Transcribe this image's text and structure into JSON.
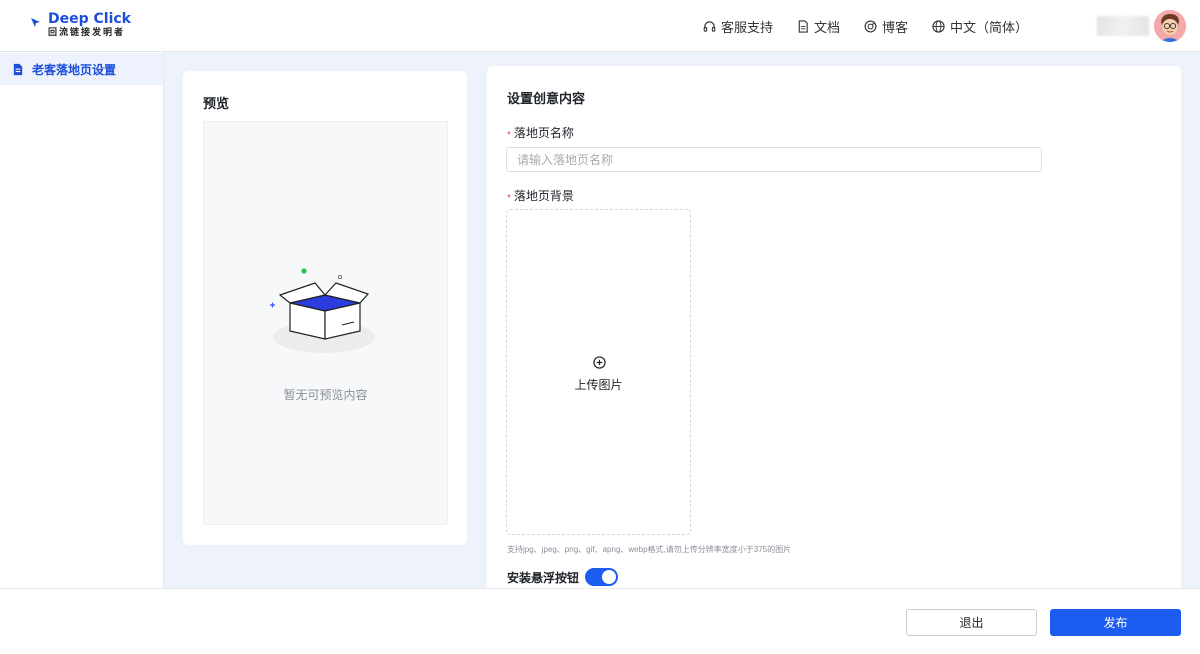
{
  "header": {
    "logo_title": "Deep Click",
    "logo_subtitle": "回流链接发明者",
    "nav": [
      {
        "label": "客服支持",
        "icon": "headset-icon"
      },
      {
        "label": "文档",
        "icon": "document-icon"
      },
      {
        "label": "博客",
        "icon": "blog-icon"
      },
      {
        "label": "中文（简体）",
        "icon": "globe-icon"
      }
    ]
  },
  "sidebar": {
    "items": [
      {
        "label": "老客落地页设置",
        "icon": "page-settings-icon",
        "active": true
      }
    ]
  },
  "preview": {
    "title": "预览",
    "empty_text": "暂无可预览内容"
  },
  "form": {
    "title": "设置创意内容",
    "name_label": "落地页名称",
    "name_placeholder": "请输入落地页名称",
    "name_value": "",
    "required_mark": "*",
    "background_label": "落地页背景",
    "upload_label": "上传图片",
    "upload_hint": "支持jpg、jpeg、png、gif、apng、webp格式,请勿上传分辨率宽度小于375的图片",
    "float_button_label": "安装悬浮按钮",
    "float_button_enabled": true
  },
  "footer": {
    "exit_label": "退出",
    "publish_label": "发布"
  },
  "colors": {
    "accent": "#1d5cf0",
    "brand": "#1d4ed8",
    "required": "#e5484d",
    "page_bg": "#eef2fb"
  }
}
